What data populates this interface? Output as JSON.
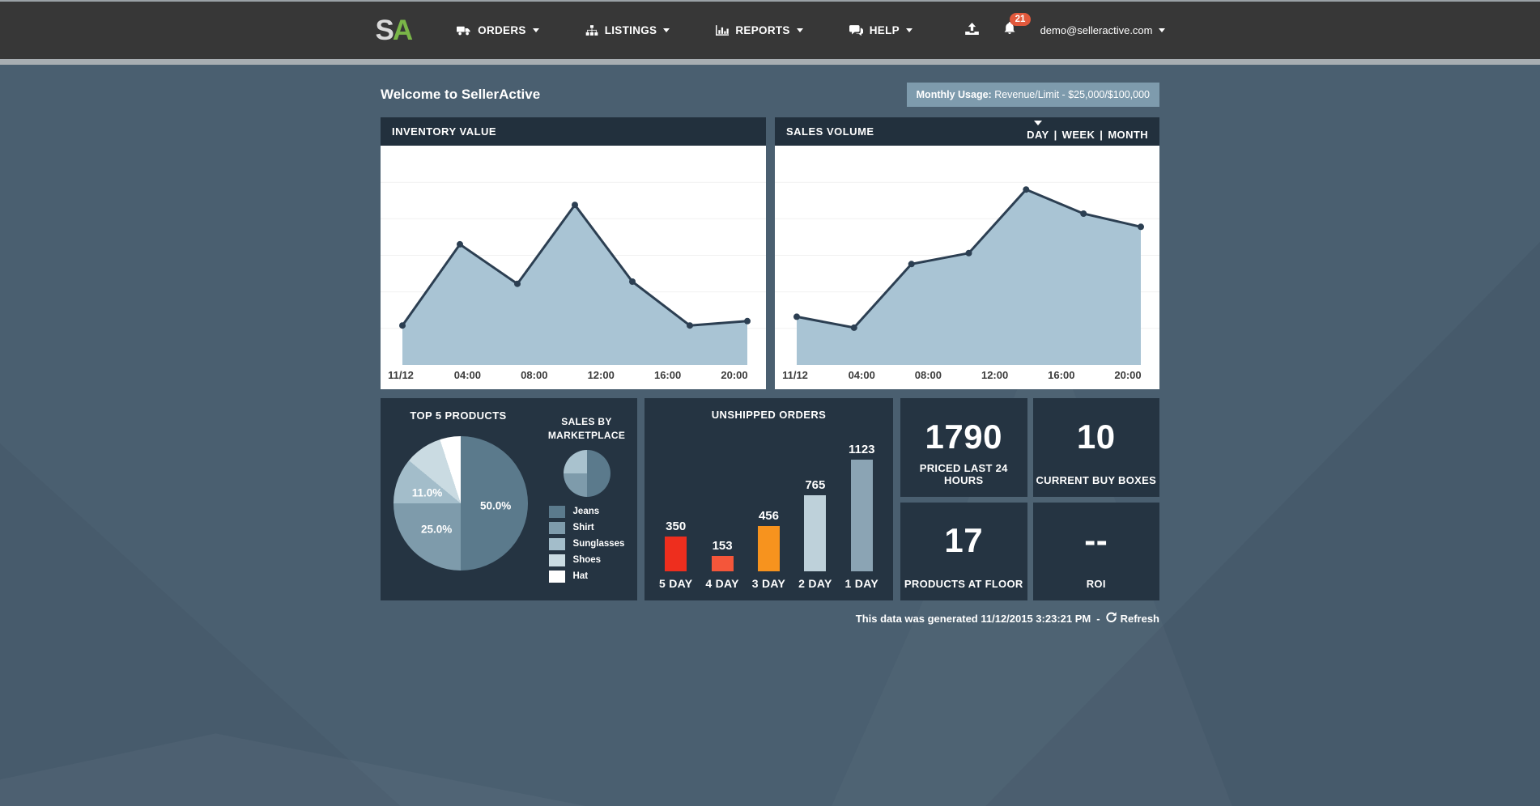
{
  "navbar": {
    "logo_s": "S",
    "logo_a": "A",
    "menu": [
      {
        "label": "ORDERS",
        "icon": "truck-icon"
      },
      {
        "label": "LISTINGS",
        "icon": "sitemap-icon"
      },
      {
        "label": "REPORTS",
        "icon": "bar-chart-icon"
      },
      {
        "label": "HELP",
        "icon": "chat-icon"
      }
    ],
    "notification_count": "21",
    "account_email": "demo@selleractive.com"
  },
  "header": {
    "welcome": "Welcome to SellerActive",
    "monthly_usage_label": "Monthly Usage:",
    "monthly_usage_value": "Revenue/Limit - $25,000/$100,000"
  },
  "chart_data": [
    {
      "type": "area",
      "title": "INVENTORY VALUE",
      "x_ticks": [
        "11/12",
        "04:00",
        "08:00",
        "12:00",
        "16:00",
        "20:00"
      ],
      "values": [
        18,
        55,
        37,
        73,
        38,
        18,
        20
      ],
      "ylim": [
        0,
        100
      ],
      "grid": true,
      "line_color": "#2c3f52",
      "fill_color": "#a9c4d4"
    },
    {
      "type": "area",
      "title": "SALES VOLUME",
      "period_options": [
        "DAY",
        "WEEK",
        "MONTH"
      ],
      "period_separator": "|",
      "selected_period": "DAY",
      "x_ticks": [
        "11/12",
        "04:00",
        "08:00",
        "12:00",
        "16:00",
        "20:00"
      ],
      "values": [
        22,
        17,
        46,
        51,
        80,
        69,
        63
      ],
      "ylim": [
        0,
        100
      ],
      "grid": true,
      "line_color": "#2c3f52",
      "fill_color": "#a9c4d4"
    },
    {
      "type": "pie",
      "title": "TOP 5 PRODUCTS",
      "labels": [
        "Jeans",
        "Shirt",
        "Sunglasses",
        "Shoes",
        "Hat"
      ],
      "values": [
        50,
        25,
        11,
        9,
        5
      ],
      "colors": [
        "#5b7a8c",
        "#7e9bab",
        "#a3bdca",
        "#cadbe2",
        "#ffffff"
      ],
      "slice_labels": [
        "50.0%",
        "25.0%",
        "11.0%"
      ]
    },
    {
      "type": "pie",
      "title": "SALES BY MARKETPLACE",
      "values": [
        50,
        25,
        25
      ],
      "colors": [
        "#5b7a8c",
        "#7e9bab",
        "#a9c2ce"
      ]
    },
    {
      "type": "bar",
      "title": "UNSHIPPED ORDERS",
      "categories": [
        "5 DAY",
        "4 DAY",
        "3 DAY",
        "2 DAY",
        "1 DAY"
      ],
      "values": [
        350,
        153,
        456,
        765,
        1123
      ],
      "colors": [
        "#ee2e1e",
        "#f4563a",
        "#f7931e",
        "#bed1da",
        "#8ba4b4"
      ],
      "ylim": [
        0,
        1123
      ]
    }
  ],
  "stats": [
    {
      "value": "1790",
      "label": "PRICED LAST 24 HOURS"
    },
    {
      "value": "10",
      "label": "CURRENT BUY BOXES"
    },
    {
      "value": "17",
      "label": "PRODUCTS AT FLOOR"
    },
    {
      "value": "--",
      "label": "ROI"
    }
  ],
  "footer": {
    "generated_text": "This data was generated 11/12/2015 3:23:21 PM",
    "separator": "-",
    "refresh_label": "Refresh"
  }
}
